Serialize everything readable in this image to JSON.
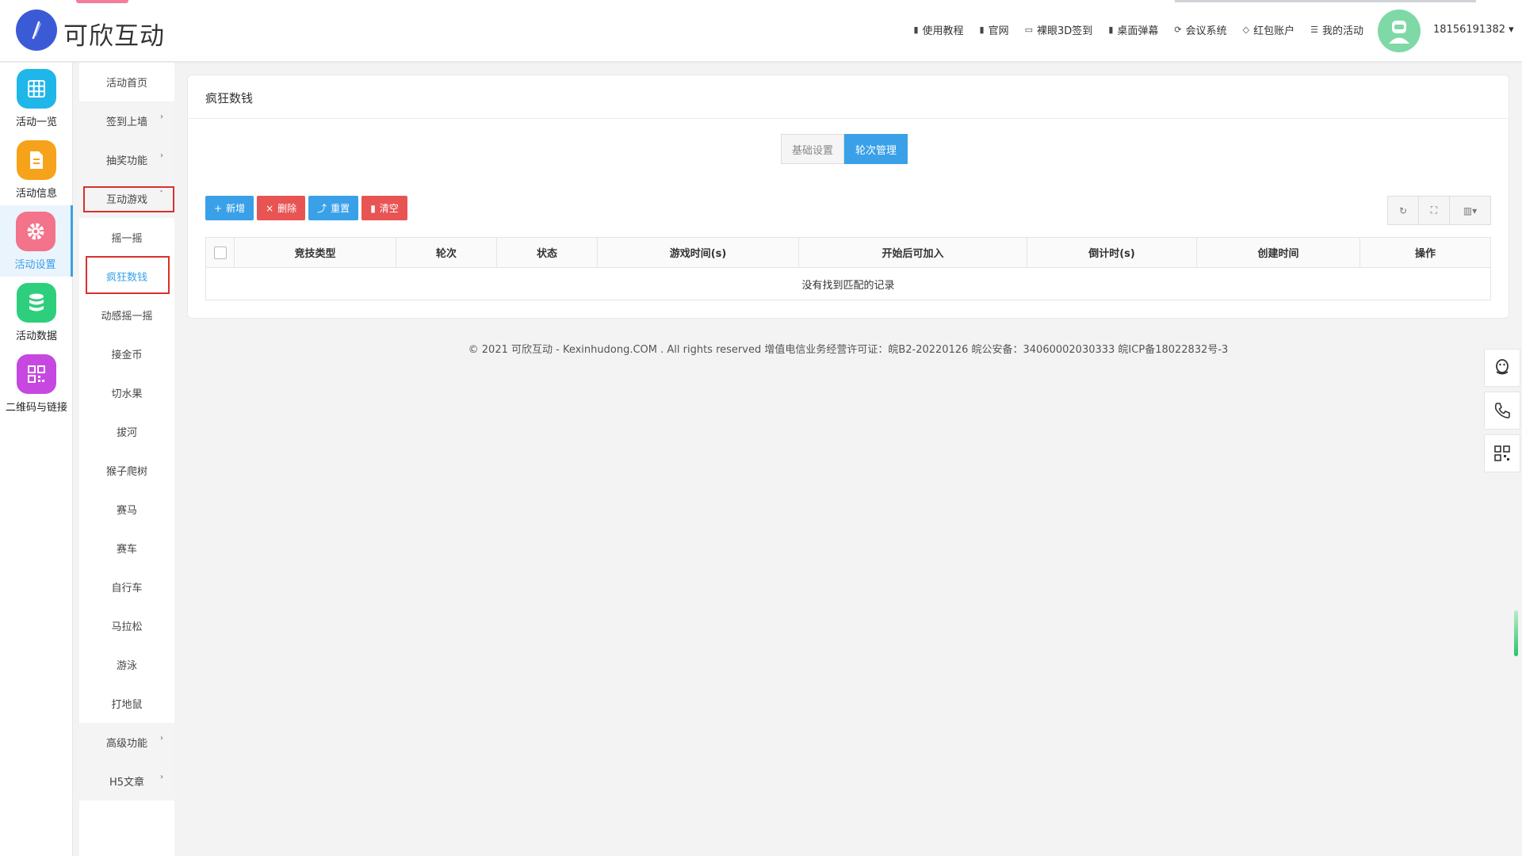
{
  "app": {
    "logo_text": "可欣互动"
  },
  "top_nav": [
    {
      "icon": "document-icon",
      "label": "使用教程"
    },
    {
      "icon": "document-icon",
      "label": "官网"
    },
    {
      "icon": "monitor-icon",
      "label": "裸眼3D签到"
    },
    {
      "icon": "document-icon",
      "label": "桌面弹幕"
    },
    {
      "icon": "meeting-icon",
      "label": "会议系统"
    },
    {
      "icon": "diamond-icon",
      "label": "红包账户"
    },
    {
      "icon": "list-icon",
      "label": "我的活动"
    }
  ],
  "user": {
    "phone": "18156191382 ▾"
  },
  "rail": [
    {
      "label": "活动一览",
      "color": "#1fb6e9",
      "icon": "grid-icon"
    },
    {
      "label": "活动信息",
      "color": "#f7a21b",
      "icon": "document-icon"
    },
    {
      "label": "活动设置",
      "color": "#f2738a",
      "icon": "gear-icon"
    },
    {
      "label": "活动数据",
      "color": "#2ecf7c",
      "icon": "database-icon"
    },
    {
      "label": "二维码与链接",
      "color": "#c648e0",
      "icon": "qrcode-icon"
    }
  ],
  "submenu": {
    "items": [
      {
        "label": "活动首页"
      },
      {
        "label": "签到上墙"
      },
      {
        "label": "抽奖功能"
      },
      {
        "label": "互动游戏"
      },
      {
        "label": "摇一摇"
      },
      {
        "label": "疯狂数钱"
      },
      {
        "label": "动感摇一摇"
      },
      {
        "label": "接金币"
      },
      {
        "label": "切水果"
      },
      {
        "label": "拔河"
      },
      {
        "label": "猴子爬树"
      },
      {
        "label": "赛马"
      },
      {
        "label": "赛车"
      },
      {
        "label": "自行车"
      },
      {
        "label": "马拉松"
      },
      {
        "label": "游泳"
      },
      {
        "label": "打地鼠"
      },
      {
        "label": "高级功能"
      },
      {
        "label": "H5文章"
      }
    ]
  },
  "main": {
    "title": "疯狂数钱",
    "tabs": [
      "基础设置",
      "轮次管理"
    ],
    "toolbar": {
      "add": "新增",
      "delete": "删除",
      "reset": "重置",
      "clear": "清空"
    },
    "table": {
      "headers": [
        "竞技类型",
        "轮次",
        "状态",
        "游戏时间(s)",
        "开始后可加入",
        "倒计时(s)",
        "创建时间",
        "操作"
      ],
      "empty_text": "没有找到匹配的记录"
    }
  },
  "footer": {
    "text": "© 2021 可欣互动 - Kexinhudong.COM . All rights reserved 增值电信业务经营许可证：皖B2-20220126 皖公安备：34060002030333 皖ICP备18022832号-3"
  }
}
